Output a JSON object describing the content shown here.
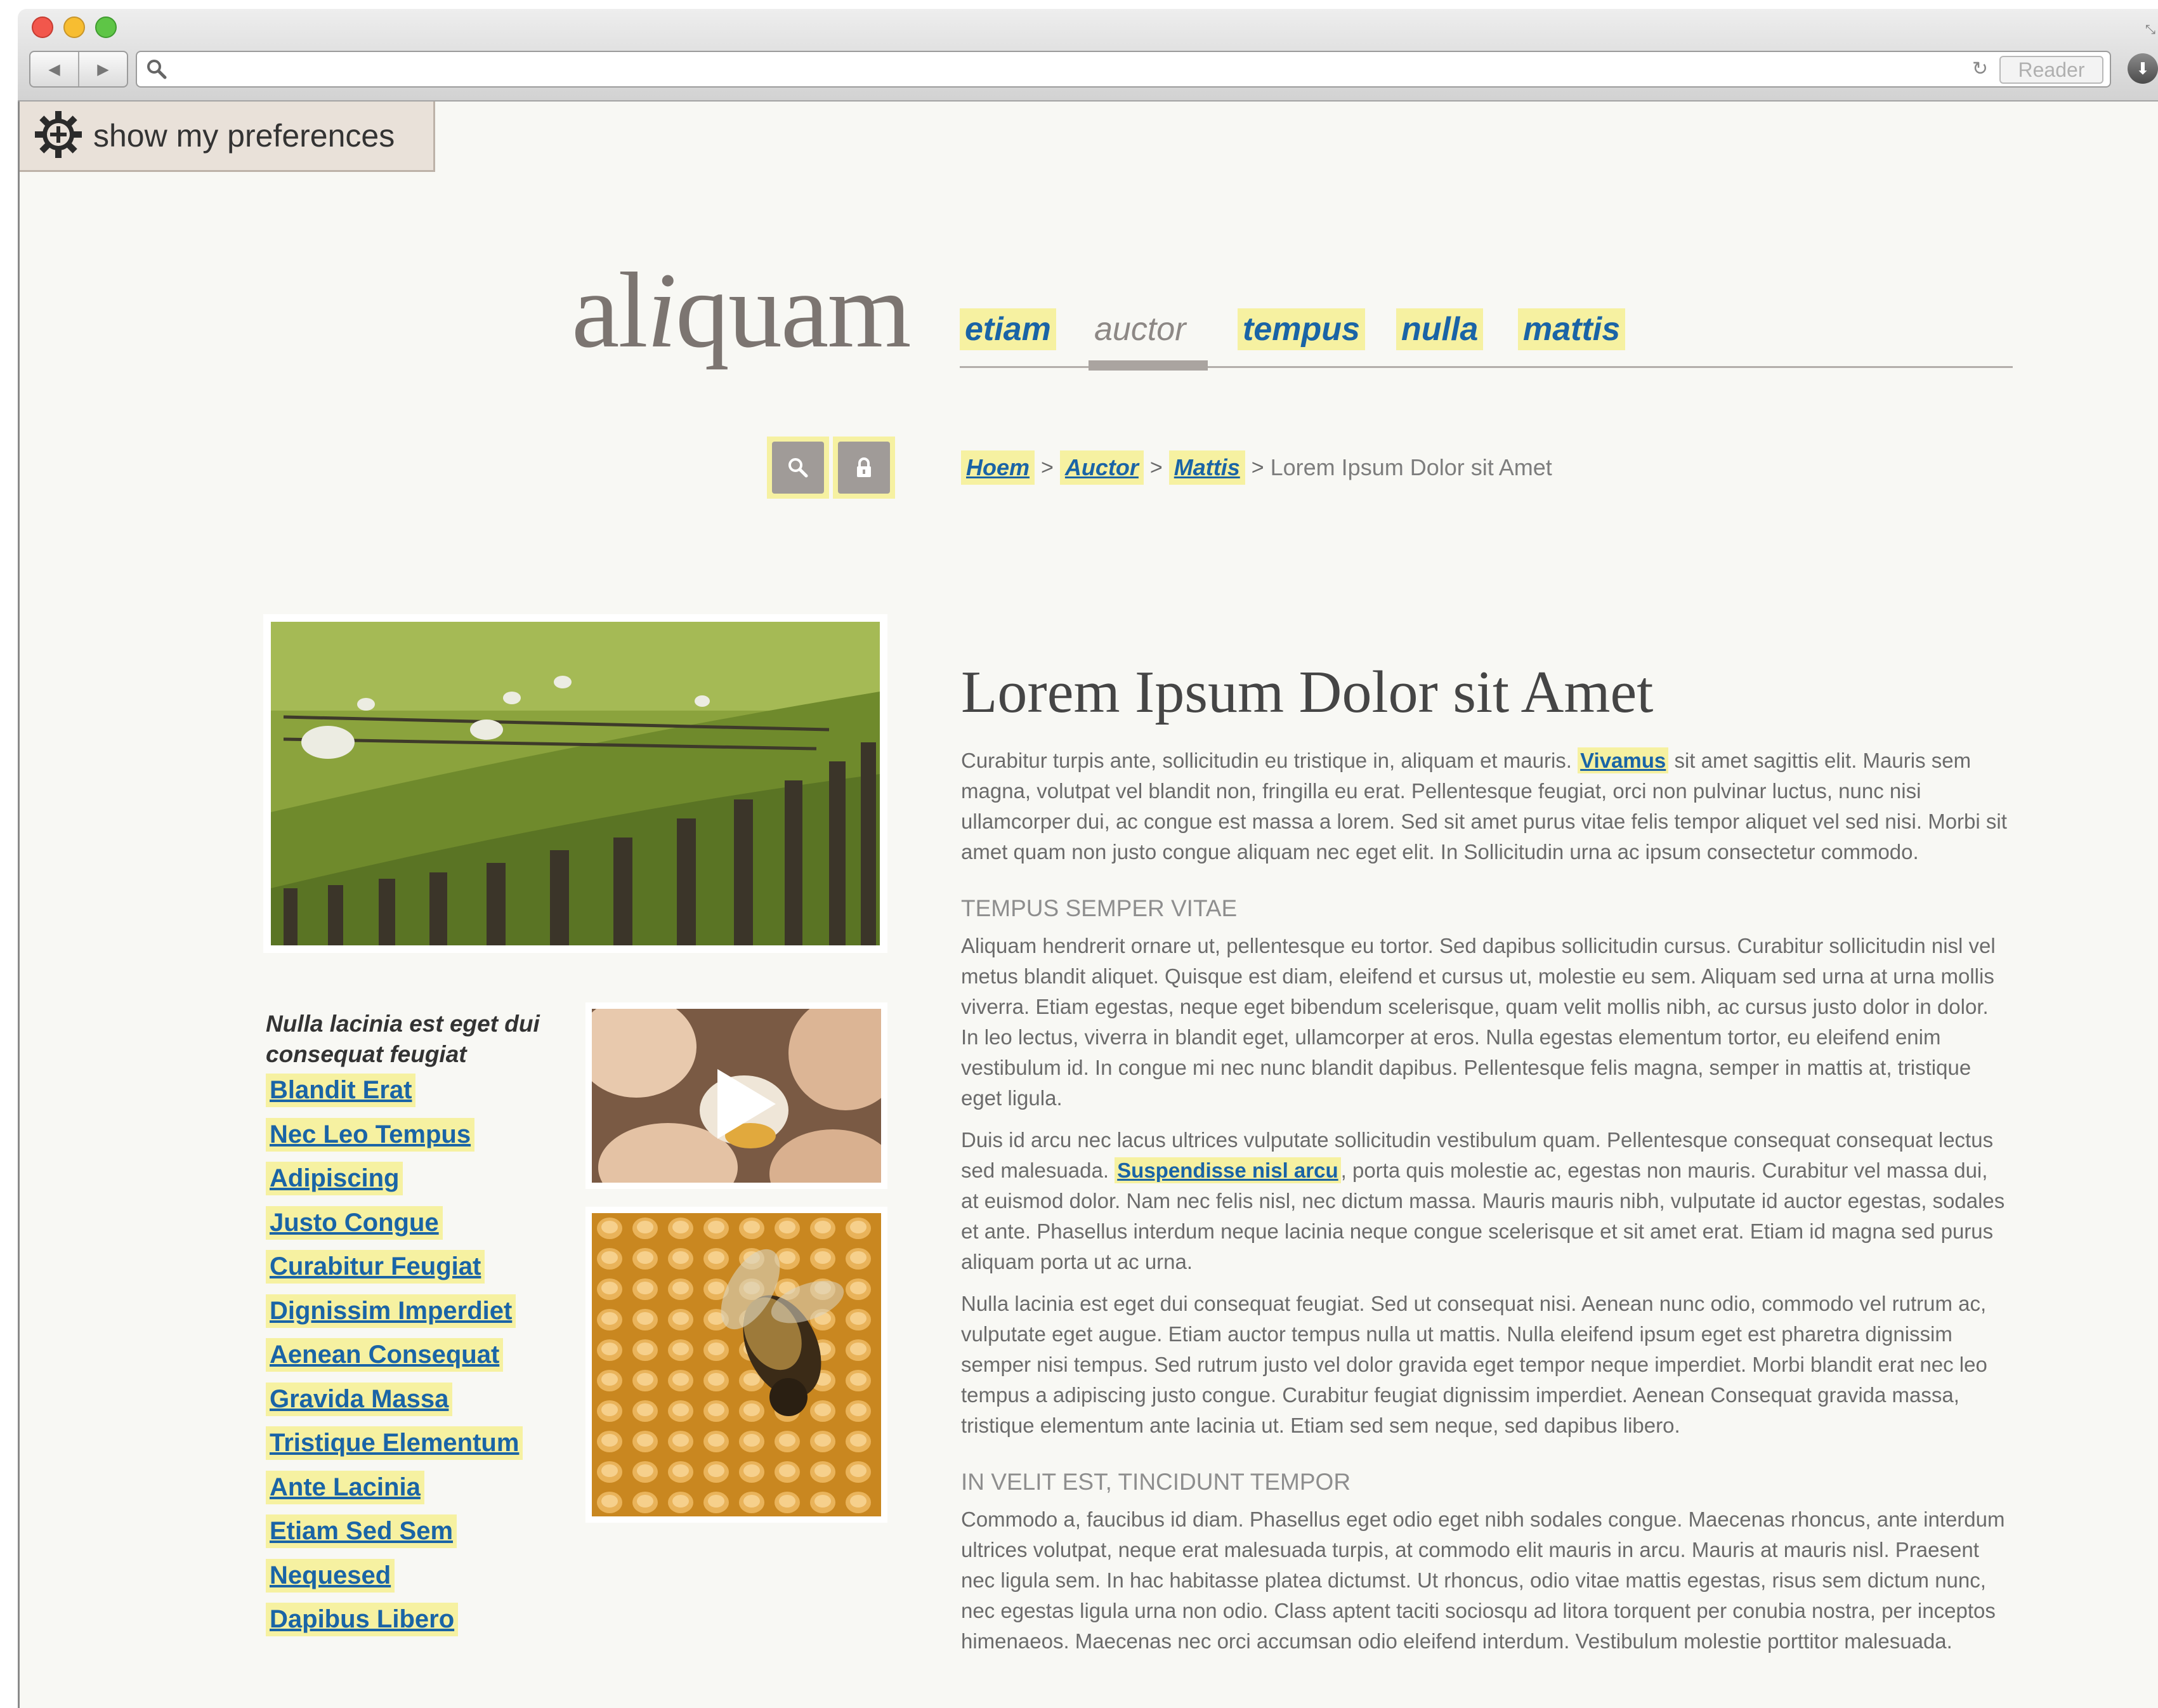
{
  "browser": {
    "reader_label": "Reader",
    "back_icon": "back-arrow-icon",
    "forward_icon": "forward-arrow-icon",
    "reload_icon": "reload-icon",
    "download_icon": "download-icon"
  },
  "preferences": {
    "label": "show my preferences",
    "icon": "gear-plus-icon"
  },
  "logo": {
    "prefix": "al",
    "italic": "i",
    "suffix": "quam"
  },
  "nav": {
    "items": [
      {
        "label": "etiam",
        "active": false
      },
      {
        "label": "auctor",
        "active": true
      },
      {
        "label": "tempus",
        "active": false
      },
      {
        "label": "nulla",
        "active": false
      },
      {
        "label": "mattis",
        "active": false
      }
    ]
  },
  "tools": {
    "search_icon": "search-icon",
    "lock_icon": "lock-icon"
  },
  "breadcrumb": {
    "items": [
      "Hoem",
      "Auctor",
      "Mattis"
    ],
    "current": "Lorem Ipsum Dolor sit Amet"
  },
  "sidebar": {
    "title": "Nulla lacinia est eget dui consequat feugiat",
    "links": [
      "Blandit Erat",
      "Nec Leo Tempus",
      "Adipiscing",
      "Justo Congue",
      "Curabitur Feugiat",
      "Dignissim Imperdiet",
      "Aenean Consequat",
      "Gravida Massa",
      "Tristique Elementum",
      "Ante Lacinia",
      "Etiam Sed Sem",
      "Nequesed",
      "Dapibus Libero"
    ]
  },
  "media": {
    "hero": "sheep pasture with wooden fence",
    "video": "eggs with play button",
    "video_icon": "play-icon",
    "bee": "bee on honeycomb"
  },
  "article": {
    "title": "Lorem Ipsum Dolor sit Amet",
    "p1_before": "Curabitur turpis ante, sollicitudin eu tristique in, aliquam et mauris. ",
    "p1_link": "Vivamus",
    "p1_after": " sit amet sagittis elit. Mauris sem magna, volutpat vel blandit non, fringilla eu erat. Pellentesque feugiat, orci non pulvinar luctus, nunc nisi ullamcorper dui, ac congue est massa a lorem. Sed sit amet purus vitae felis tempor aliquet vel sed nisi. Morbi sit amet quam non justo congue aliquam nec eget elit. In Sollicitudin urna ac ipsum consectetur commodo.",
    "h2_1": "TEMPUS SEMPER VITAE",
    "p2": "Aliquam hendrerit ornare ut, pellentesque eu tortor. Sed dapibus sollicitudin cursus. Curabitur sollicitudin nisl vel metus blandit aliquet. Quisque est diam, eleifend et cursus ut, molestie eu sem. Aliquam sed urna at urna mollis viverra. Etiam egestas, neque eget bibendum scelerisque, quam velit mollis nibh, ac cursus justo dolor in dolor. In leo lectus, viverra in blandit eget, ullamcorper at eros. Nulla egestas elementum tortor, eu eleifend enim vestibulum id. In congue mi nec nunc blandit dapibus. Pellentesque felis magna, semper in mattis at, tristique eget ligula.",
    "p3_before": "Duis id arcu nec lacus ultrices vulputate sollicitudin vestibulum quam. Pellentesque consequat consequat lectus sed malesuada. ",
    "p3_link": "Suspendisse nisl arcu",
    "p3_after": ", porta quis molestie ac, egestas non mauris. Curabitur vel massa dui, at euismod dolor. Nam nec felis nisl, nec dictum massa. Mauris mauris nibh, vulputate id auctor egestas, sodales et ante. Phasellus interdum neque lacinia neque congue scelerisque et sit amet erat. Etiam id magna sed purus aliquam porta ut ac urna.",
    "p4": "Nulla lacinia est eget dui consequat feugiat. Sed ut consequat nisi. Aenean nunc odio, commodo vel rutrum ac, vulputate eget augue. Etiam auctor tempus nulla ut mattis. Nulla eleifend ipsum eget est pharetra dignissim semper nisi tempus. Sed rutrum justo vel dolor gravida eget tempor neque imperdiet. Morbi blandit erat nec leo tempus a adipiscing justo congue. Curabitur feugiat dignissim imperdiet. Aenean Consequat gravida massa, tristique elementum ante lacinia ut. Etiam sed sem neque, sed dapibus libero.",
    "h2_2": "IN VELIT EST, TINCIDUNT TEMPOR",
    "p5": "Commodo a, faucibus id diam. Phasellus eget odio eget nibh sodales congue. Maecenas rhoncus, ante interdum ultrices volutpat, neque erat malesuada turpis, at commodo elit mauris in arcu. Mauris at mauris nisl. Praesent nec ligula sem. In hac habitasse platea dictumst. Ut rhoncus, odio vitae mattis egestas, risus sem dictum nunc, nec egestas ligula urna non odio. Class aptent taciti sociosqu ad litora torquent per conubia nostra, per inceptos himenaeos. Maecenas nec orci accumsan odio eleifend interdum. Vestibulum molestie porttitor malesuada."
  },
  "colors": {
    "link": "#1a64a6",
    "highlight": "#f6f1a1",
    "page_bg": "#f8f8f4",
    "pref_bg": "#e9e1d9"
  }
}
